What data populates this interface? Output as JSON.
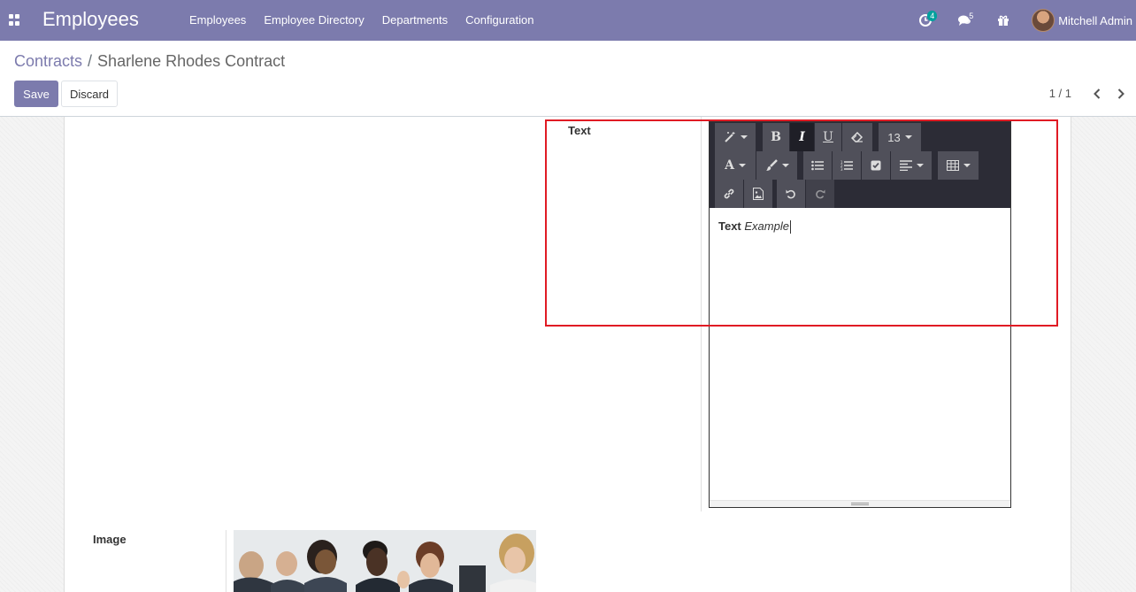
{
  "navbar": {
    "brand": "Employees",
    "menu": [
      "Employees",
      "Employee Directory",
      "Departments",
      "Configuration"
    ],
    "activity_badge": "4",
    "messages_badge": "5",
    "user_name": "Mitchell Admin"
  },
  "breadcrumb": {
    "parent": "Contracts",
    "separator": "/",
    "current": "Sharlene Rhodes Contract"
  },
  "buttons": {
    "save": "Save",
    "discard": "Discard"
  },
  "pager": {
    "value": "1 / 1"
  },
  "form": {
    "text_label": "Text",
    "image_label": "Image",
    "editor": {
      "font_size": "13",
      "content_bold": "Text",
      "content_italic": "Example"
    }
  },
  "colors": {
    "brand": "#7c7bad",
    "highlight": "#e01b24",
    "toolbar": "#2c2c36"
  }
}
